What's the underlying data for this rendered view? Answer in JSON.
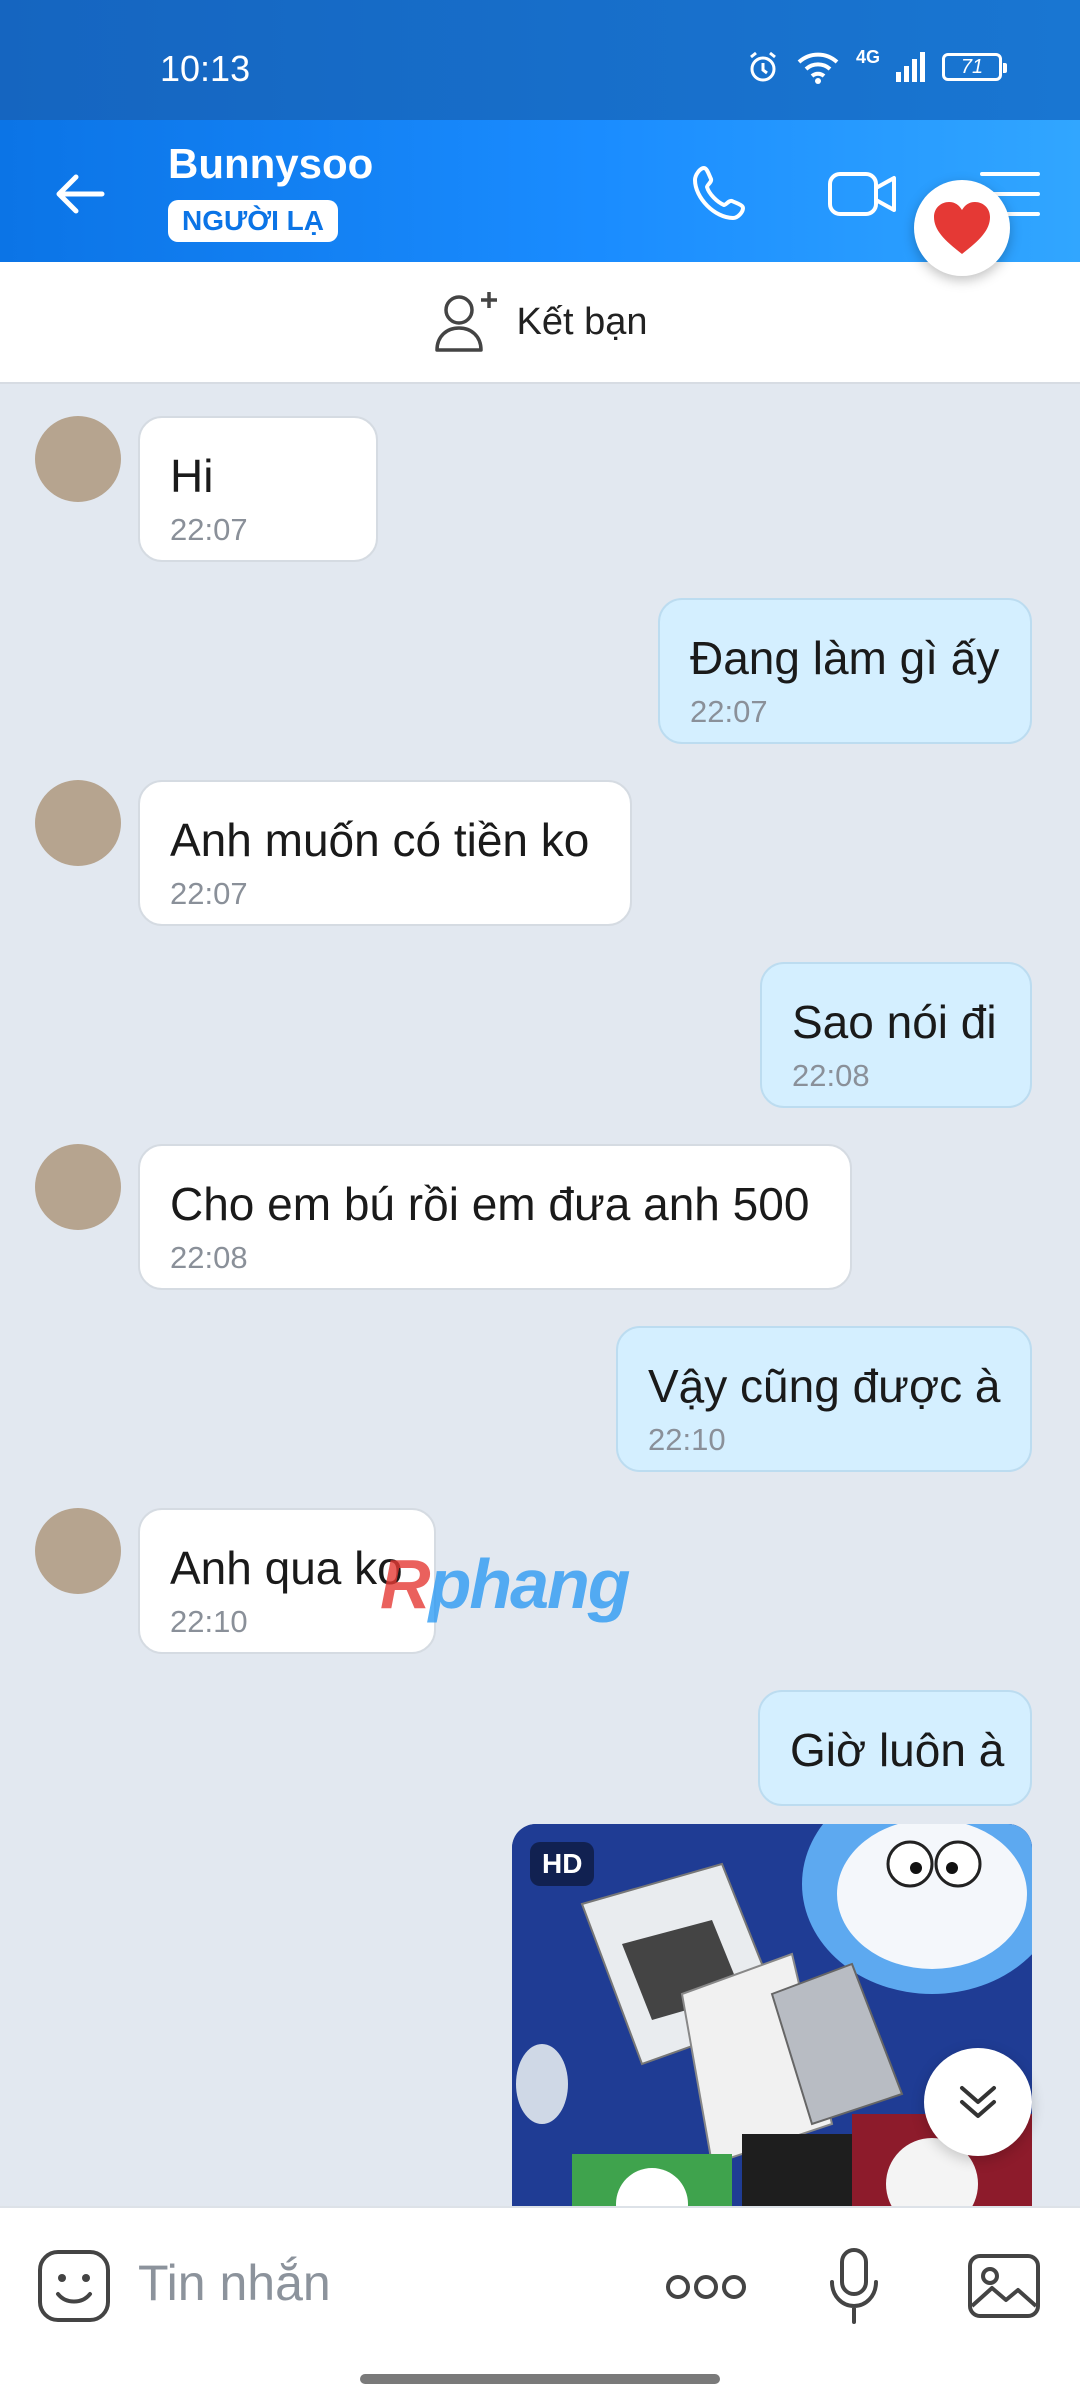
{
  "status_bar": {
    "time": "10:13",
    "network": "4G",
    "battery": "71"
  },
  "header": {
    "contact_name": "Bunnysoo",
    "stranger_badge": "NGƯỜI LẠ"
  },
  "friend_bar": {
    "label": "Kết bạn"
  },
  "messages": [
    {
      "direction": "in",
      "text": "Hi",
      "time": "22:07"
    },
    {
      "direction": "out",
      "text": "Đang làm gì ấy",
      "time": "22:07"
    },
    {
      "direction": "in",
      "text": "Anh muốn có tiền ko",
      "time": "22:07"
    },
    {
      "direction": "out",
      "text": "Sao nói đi",
      "time": "22:08"
    },
    {
      "direction": "in",
      "text": "Cho em bú rồi em đưa anh 500",
      "time": "22:08"
    },
    {
      "direction": "out",
      "text": "Vậy cũng được à",
      "time": "22:10"
    },
    {
      "direction": "in",
      "text": "Anh qua ko",
      "time": "22:10"
    },
    {
      "direction": "out",
      "text": "Giờ luôn à",
      "time": ""
    }
  ],
  "image_message": {
    "badge": "HD"
  },
  "watermark": {
    "prefix": "R",
    "rest": "phang"
  },
  "composer": {
    "placeholder": "Tin nhắn"
  },
  "colors": {
    "header_blue": "#0b74e6",
    "outgoing_bubble": "#d4efff",
    "chat_background": "#e2e8f0"
  }
}
